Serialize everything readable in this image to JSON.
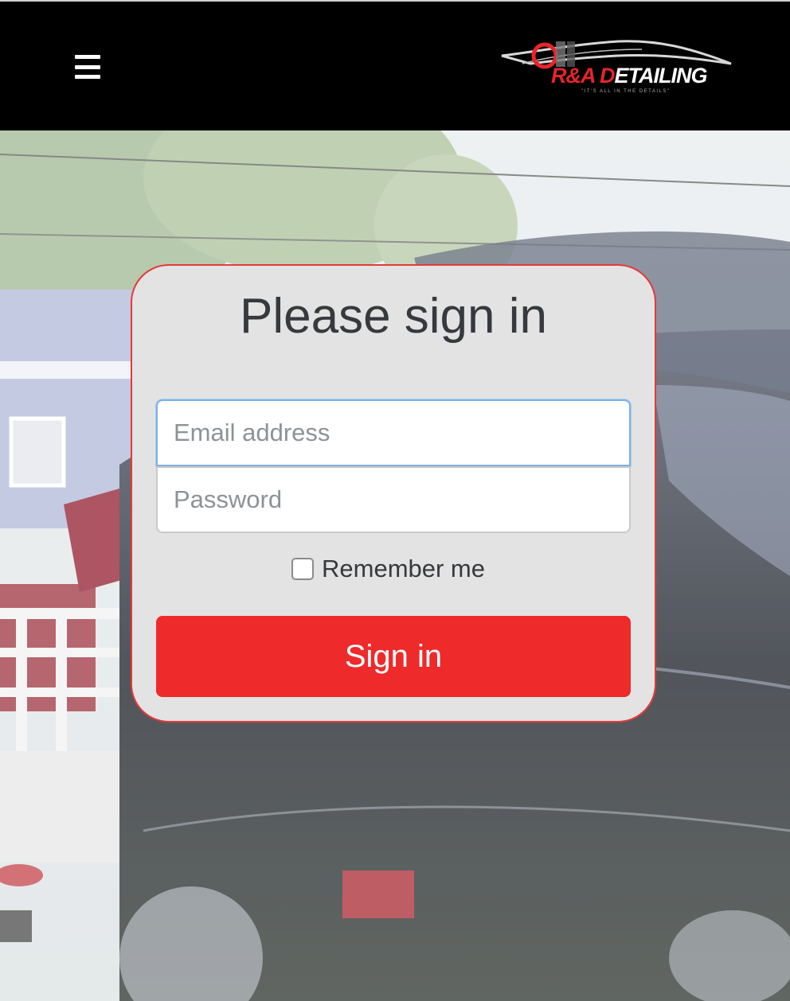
{
  "header": {
    "menu_icon": "hamburger-menu-icon",
    "logo": {
      "brand_red": "R&A D",
      "brand_white": "ETAILING",
      "tagline": "\"IT'S ALL IN THE DETAILS\""
    }
  },
  "signin": {
    "title": "Please sign in",
    "email_placeholder": "Email address",
    "password_placeholder": "Password",
    "remember_label": "Remember me",
    "remember_checked": false,
    "button_label": "Sign in"
  },
  "colors": {
    "header_bg": "#000000",
    "card_bg": "#e3e3e3",
    "card_border": "#e33a3a",
    "accent_red": "#ee2a2a",
    "focus_blue": "#7fb1e6"
  }
}
